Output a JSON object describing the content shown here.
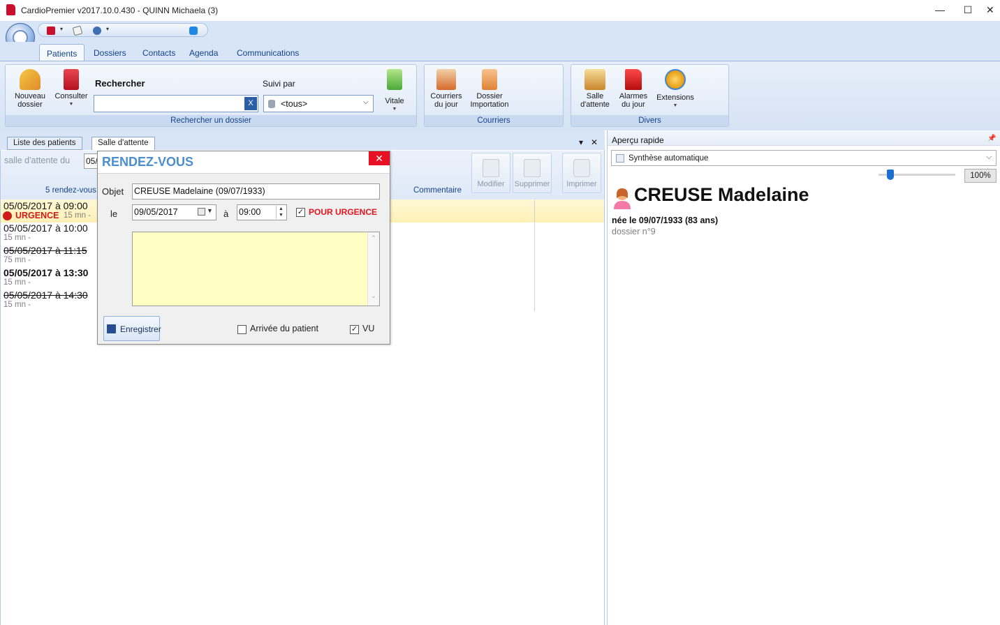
{
  "window": {
    "title": "CardioPremier v2017.10.0.430 - QUINN Michaela (3)",
    "minimize": "—",
    "maximize": "☐",
    "close": "✕"
  },
  "ribbon": {
    "tabs": [
      "Patients",
      "Dossiers",
      "Contacts",
      "Agenda",
      "Communications"
    ],
    "active_tab": "Patients",
    "groups": {
      "search": {
        "caption": "Rechercher un dossier",
        "new_label_1": "Nouveau",
        "new_label_2": "dossier",
        "consult_label": "Consulter",
        "search_title": "Rechercher",
        "search_value": "",
        "clear_label": "X",
        "followed_by_label": "Suivi par",
        "followed_by_value": "<tous>",
        "vitale_label": "Vitale"
      },
      "mail": {
        "caption": "Courriers",
        "today_mail_1": "Courriers",
        "today_mail_2": "du jour",
        "import_1": "Dossier",
        "import_2": "Importation"
      },
      "misc": {
        "caption": "Divers",
        "waiting_1": "Salle",
        "waiting_2": "d'attente",
        "alarms_1": "Alarmes",
        "alarms_2": "du jour",
        "extensions": "Extensions"
      }
    }
  },
  "doc_tabs": {
    "patients_list": "Liste des patients",
    "waiting_room": "Salle d'attente",
    "pin": "▾",
    "close": "✕"
  },
  "waiting_room": {
    "date_label": "salle d'attente du",
    "date_value": "05/",
    "count_label": "5 rendez-vous",
    "comment_header": "Commentaire",
    "modify": "Modifier",
    "delete": "Supprimer",
    "print": "Imprimer",
    "appointments": [
      {
        "datetime": "05/05/2017 à 09:00",
        "badge": "URGENCE",
        "duration": "15 mn -"
      },
      {
        "datetime": "05/05/2017 à 10:00",
        "duration": "15 mn -"
      },
      {
        "datetime": "05/05/2017 à 11:15",
        "duration": "75 mn -"
      },
      {
        "datetime": "05/05/2017 à 13:30",
        "duration": "15 mn -"
      },
      {
        "datetime": "05/05/2017 à 14:30",
        "duration": "15 mn -"
      }
    ]
  },
  "dialog": {
    "title": "RENDEZ-VOUS",
    "close": "✕",
    "object_label": "Objet",
    "object_value": "CREUSE Madelaine (09/07/1933)",
    "date_label": "le",
    "date_value": "09/05/2017",
    "time_label": "à",
    "time_value": "09:00",
    "urgent_label": "POUR URGENCE",
    "urgent_checked": "✓",
    "arrival_label": "Arrivée du patient",
    "seen_label": "VU",
    "seen_checked": "✓",
    "save_label": "Enregistrer"
  },
  "quick_view": {
    "title": "Aperçu rapide",
    "pin": "📌",
    "mode": "Synthèse automatique",
    "zoom": "100%",
    "zoom_level": 0.15,
    "patient_name": "CREUSE Madelaine",
    "birth": "née le 09/07/1933 (83 ans)",
    "file_no": "dossier n°9"
  }
}
